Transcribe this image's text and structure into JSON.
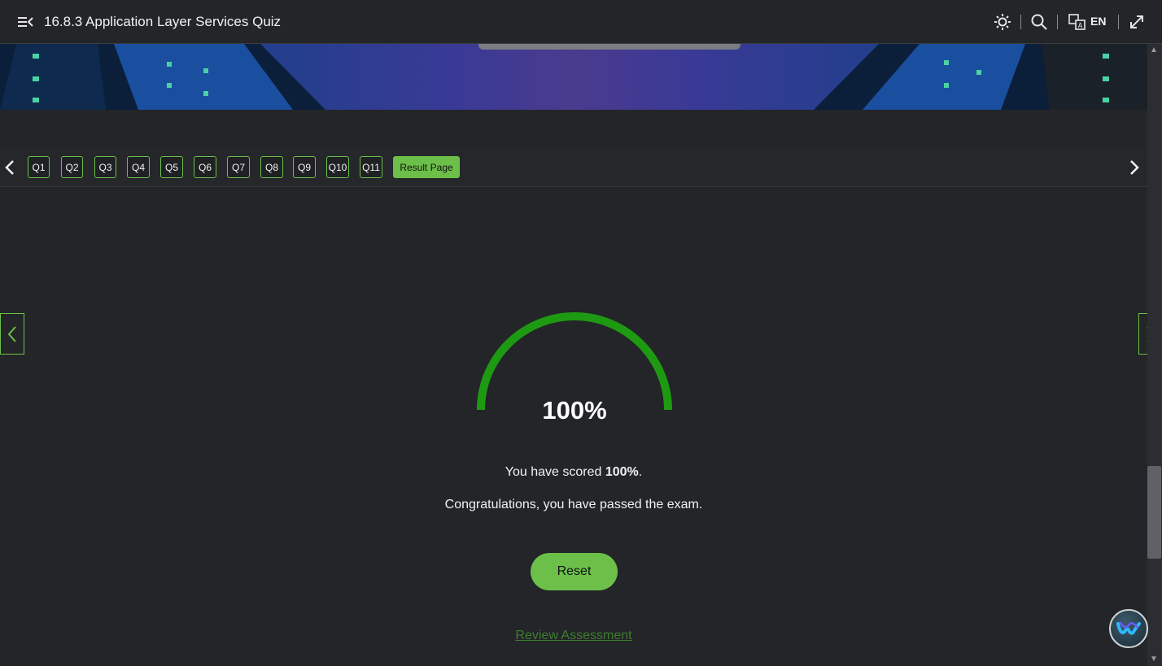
{
  "header": {
    "title": "16.8.3 Application Layer Services Quiz",
    "language": "EN"
  },
  "qnav": {
    "questions": [
      "Q1",
      "Q2",
      "Q3",
      "Q4",
      "Q5",
      "Q6",
      "Q7",
      "Q8",
      "Q9",
      "Q10",
      "Q11"
    ],
    "result_label": "Result Page"
  },
  "result": {
    "score_display": "100%",
    "score_fraction": 1.0,
    "scored_prefix": "You have scored ",
    "scored_value": "100%",
    "scored_suffix": ".",
    "message": "Congratulations, you have passed the exam.",
    "reset_label": "Reset",
    "review_label": "Review Assessment"
  },
  "colors": {
    "accent": "#6cc04a",
    "gauge": "#1e9a12",
    "background": "#232528"
  }
}
